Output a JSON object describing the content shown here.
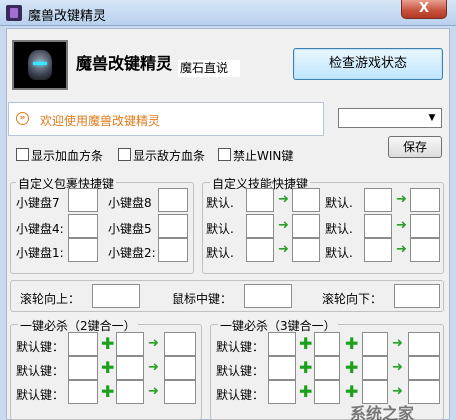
{
  "window": {
    "title": "魔兽改键精灵",
    "close_glyph": "X"
  },
  "header": {
    "app_name": "魔兽改键精灵",
    "sub_name": "魔石直说",
    "check_button": "检查游戏状态"
  },
  "welcome": {
    "icon": "»",
    "text": "欢迎使用魔兽改键精灵"
  },
  "options": {
    "show_ally_hp": "显示加血方条",
    "show_enemy_hp": "显示敌方血条",
    "disable_win": "禁止WIN键"
  },
  "profile": {
    "selected": "",
    "save_label": "保存"
  },
  "inventory": {
    "title": "自定义包裹快捷键",
    "labels": [
      "小键盘7",
      "小键盘8",
      "小键盘4:",
      "小键盘5",
      "小键盘1:",
      "小键盘2:"
    ]
  },
  "skills": {
    "title": "自定义技能快捷键",
    "label": "默认.",
    "arrow": "➜"
  },
  "mouse": {
    "wheel_up": "滚轮向上：",
    "middle": "鼠标中键：",
    "wheel_down": "滚轮向下："
  },
  "combo2": {
    "title": "一键必杀（2键合一）",
    "label": "默认键：",
    "plus": "✚",
    "arrow": "➜"
  },
  "combo3": {
    "title": "一键必杀（3键合一）",
    "label": "默认键：",
    "plus": "✚",
    "arrow": "➜"
  },
  "footer": {
    "watermark": "系统之家"
  },
  "colors": {
    "accent": "#e07a1a",
    "plus": "#1aa01a"
  }
}
